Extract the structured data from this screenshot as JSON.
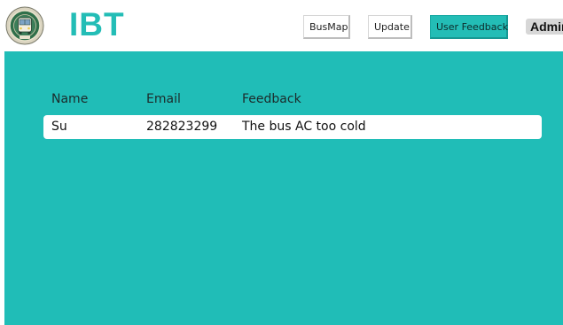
{
  "header": {
    "brand": "IBT",
    "nav": {
      "busmap": "BusMap",
      "update": "Update",
      "user_feedback": "User Feedback"
    },
    "user": "Admin"
  },
  "table": {
    "columns": [
      "Name",
      "Email",
      "Feedback"
    ],
    "rows": [
      {
        "name": "Su",
        "email": "282823299",
        "feedback": "The bus AC too cold"
      }
    ]
  },
  "colors": {
    "accent": "#20bdb7",
    "brand_text": "#23bdb6"
  },
  "icons": {
    "logo": "bus-emblem-logo"
  }
}
